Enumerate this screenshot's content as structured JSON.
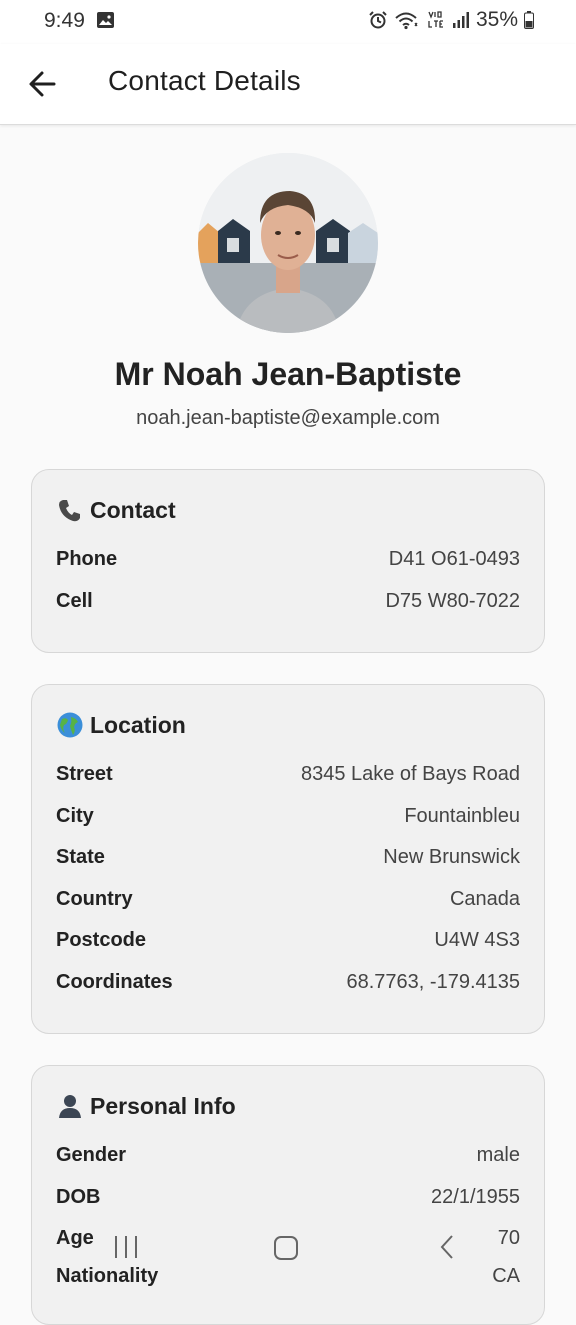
{
  "status_bar": {
    "time": "9:49",
    "battery": "35%"
  },
  "header": {
    "title": "Contact Details"
  },
  "profile": {
    "name": "Mr Noah Jean-Baptiste",
    "email": "noah.jean-baptiste@example.com"
  },
  "contact": {
    "title": "Contact",
    "rows": [
      {
        "label": "Phone",
        "value": "D41 O61-0493"
      },
      {
        "label": "Cell",
        "value": "D75 W80-7022"
      }
    ]
  },
  "location": {
    "title": "Location",
    "rows": [
      {
        "label": "Street",
        "value": "8345 Lake of Bays Road"
      },
      {
        "label": "City",
        "value": "Fountainbleu"
      },
      {
        "label": "State",
        "value": "New Brunswick"
      },
      {
        "label": "Country",
        "value": "Canada"
      },
      {
        "label": "Postcode",
        "value": "U4W 4S3"
      },
      {
        "label": "Coordinates",
        "value": "68.7763, -179.4135"
      }
    ]
  },
  "personal": {
    "title": "Personal Info",
    "rows": [
      {
        "label": "Gender",
        "value": "male"
      },
      {
        "label": "DOB",
        "value": "22/1/1955"
      },
      {
        "label": "Age",
        "value": "70"
      },
      {
        "label": "Nationality",
        "value": "CA"
      }
    ]
  },
  "icons": {
    "back": "arrow-left-icon",
    "contact": "telephone-receiver-icon",
    "location": "globe-icon",
    "personal": "person-silhouette-icon"
  }
}
